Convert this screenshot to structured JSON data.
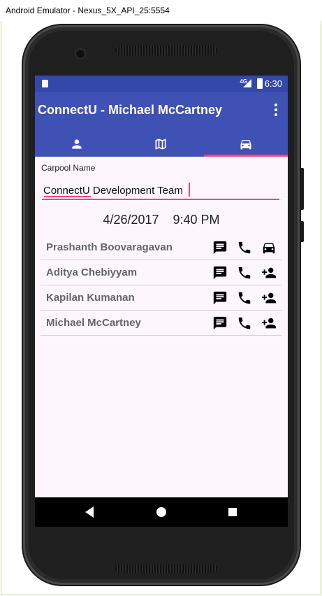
{
  "window": {
    "title": "Android Emulator - Nexus_5X_API_25:5554"
  },
  "status_bar": {
    "network": "4G",
    "time": "6:30"
  },
  "app_bar": {
    "title": "ConnectU - Michael McCartney"
  },
  "tabs": [
    {
      "icon": "person-icon"
    },
    {
      "icon": "map-icon"
    },
    {
      "icon": "car-icon",
      "selected": true
    }
  ],
  "carpool": {
    "label": "Carpool Name",
    "name_value": "ConnectU Development Team",
    "date": "4/26/2017",
    "time": "9:40 PM",
    "datetime": "4/26/2017    9:40 PM"
  },
  "members": [
    {
      "name": "Prashanth Boovaragavan",
      "actions": [
        "message-icon",
        "phone-icon",
        "car-icon"
      ]
    },
    {
      "name": "Aditya Chebiyyam",
      "actions": [
        "message-icon",
        "phone-icon",
        "add-person-icon"
      ]
    },
    {
      "name": "Kapilan Kumanan",
      "actions": [
        "message-icon",
        "phone-icon",
        "add-person-icon"
      ]
    },
    {
      "name": "Michael McCartney",
      "actions": [
        "message-icon",
        "phone-icon",
        "add-person-icon"
      ]
    }
  ],
  "colors": {
    "primary": "#3f51b5",
    "primary_dark": "#3447aa",
    "accent": "#ff4081",
    "background": "#fdf6fd"
  }
}
